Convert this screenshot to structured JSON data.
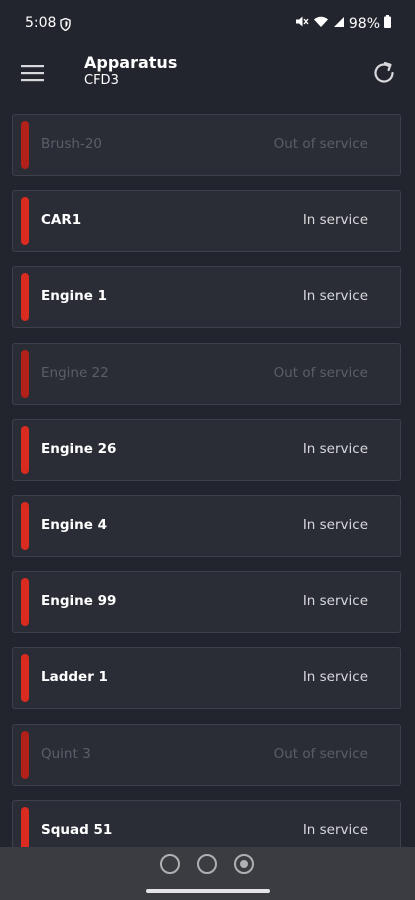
{
  "status_bar": {
    "time": "5:08",
    "battery": "98%"
  },
  "app_bar": {
    "title": "Apparatus",
    "subtitle": "CFD3"
  },
  "apparatus": [
    {
      "name": "Brush-20",
      "status": "Out of service",
      "in_service": false
    },
    {
      "name": "CAR1",
      "status": "In service",
      "in_service": true
    },
    {
      "name": "Engine 1",
      "status": "In service",
      "in_service": true
    },
    {
      "name": "Engine 22",
      "status": "Out of service",
      "in_service": false
    },
    {
      "name": "Engine 26",
      "status": "In service",
      "in_service": true
    },
    {
      "name": "Engine 4",
      "status": "In service",
      "in_service": true
    },
    {
      "name": "Engine 99",
      "status": "In service",
      "in_service": true
    },
    {
      "name": "Ladder 1",
      "status": "In service",
      "in_service": true
    },
    {
      "name": "Quint 3",
      "status": "Out of service",
      "in_service": false
    },
    {
      "name": "Squad 51",
      "status": "In service",
      "in_service": true
    }
  ],
  "colors": {
    "background": "#23252e",
    "card": "#2a2d36",
    "indicator": "#d92b1f"
  }
}
